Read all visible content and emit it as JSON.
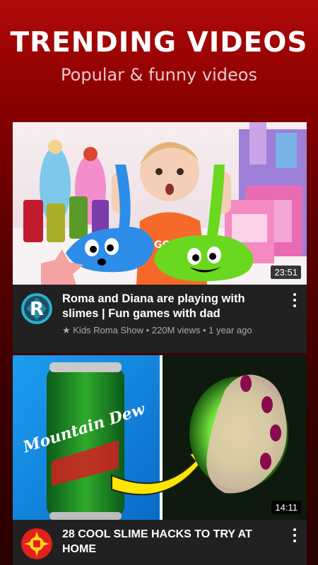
{
  "header": {
    "title": "TRENDING VIDEOS",
    "subtitle": "Popular & funny videos"
  },
  "videos": [
    {
      "title": "Roma and Diana are playing with slimes | Fun games with dad",
      "channel_line": "★ Kids Roma Show • 220M views • 1 year ago",
      "duration": "23:51",
      "avatar_letter": "R"
    },
    {
      "title": "28 COOL SLIME HACKS TO TRY AT HOME",
      "duration": "14:11",
      "thumb_can_text": "Mountain Dew"
    }
  ],
  "colors": {
    "background_top": "#b00a0a",
    "background_bottom": "#2a0000",
    "card_bg": "#212121",
    "meta_text": "#aaaaaa"
  },
  "icons": {
    "more": "more-vertical-icon"
  }
}
